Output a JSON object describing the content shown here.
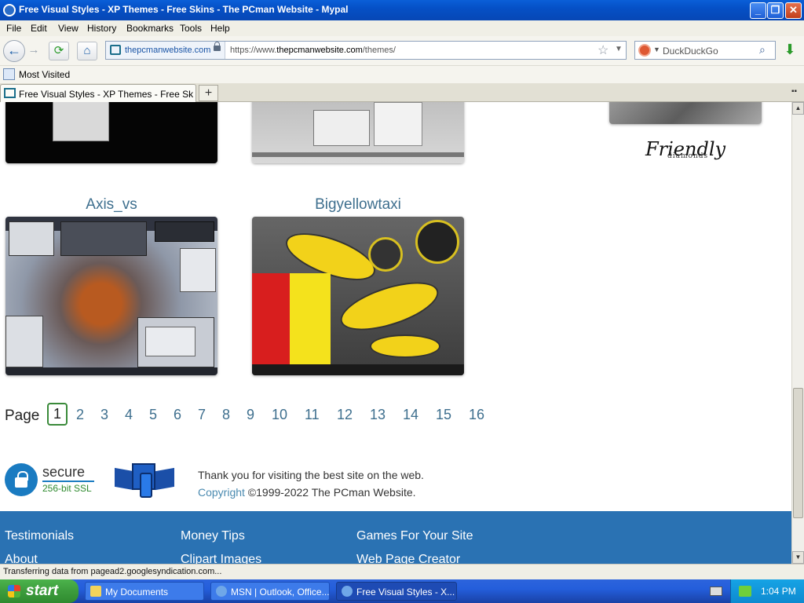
{
  "window": {
    "title": "Free Visual Styles - XP Themes - Free Skins - The PCman Website - Mypal",
    "minimize": "_",
    "maximize": "❐",
    "close": "✕"
  },
  "menu": [
    "File",
    "Edit",
    "View",
    "History",
    "Bookmarks",
    "Tools",
    "Help"
  ],
  "nav": {
    "identity_domain": "thepcmanwebsite.com",
    "url_prefix": "https://www.",
    "url_host": "thepcmanwebsite.com",
    "url_path": "/themes/",
    "search_placeholder": "DuckDuckGo"
  },
  "bookmarks": {
    "most_visited": "Most Visited"
  },
  "tabs": [
    {
      "title": "Free Visual Styles - XP Themes - Free Skins - ..."
    }
  ],
  "page": {
    "themes": [
      {
        "name": "Axis_vs"
      },
      {
        "name": "Bigyellowtaxi"
      }
    ],
    "ad_logo": {
      "script": "Friendly",
      "sub": "diamonds"
    },
    "pager": {
      "label": "Page",
      "current": "1",
      "pages": [
        "2",
        "3",
        "4",
        "5",
        "6",
        "7",
        "8",
        "9",
        "10",
        "11",
        "12",
        "13",
        "14",
        "15",
        "16"
      ]
    },
    "secure": {
      "word": "secure",
      "ssl": "256-bit SSL"
    },
    "thanks": "Thank you for visiting the best site on the web.",
    "copyright_link": "Copyright",
    "copyright_rest": " ©1999-2022 The PCman Website.",
    "footer_links": [
      "Testimonials",
      "Money Tips",
      "Games For Your Site",
      "About",
      "Clipart Images",
      "Web Page Creator"
    ]
  },
  "status": "Transferring data from pagead2.googlesyndication.com...",
  "taskbar": {
    "start": "start",
    "tasks": [
      {
        "label": "My Documents",
        "active": false
      },
      {
        "label": "MSN | Outlook, Office...",
        "active": false
      },
      {
        "label": "Free Visual Styles - X...",
        "active": true
      }
    ],
    "clock": "1:04 PM"
  },
  "colors": {
    "link": "#3e6f8e",
    "footer_bg": "#2a72b3",
    "xp_blue": "#0550c6",
    "start_green": "#3c9c3c"
  }
}
